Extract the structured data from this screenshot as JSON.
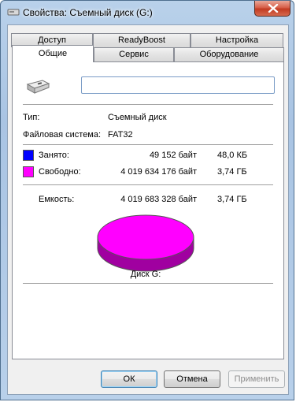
{
  "window": {
    "title": "Свойства: Съемный диск (G:)"
  },
  "tabs_row1": [
    "Доступ",
    "ReadyBoost",
    "Настройка"
  ],
  "tabs_row2": [
    "Общие",
    "Сервис",
    "Оборудование"
  ],
  "general": {
    "drive_name_value": "",
    "type_label": "Тип:",
    "type_value": "Съемный диск",
    "fs_label": "Файловая система:",
    "fs_value": "FAT32",
    "used_label": "Занято:",
    "used_bytes": "49 152 байт",
    "used_size": "48,0 КБ",
    "free_label": "Свободно:",
    "free_bytes": "4 019 634 176 байт",
    "free_size": "3,74 ГБ",
    "capacity_label": "Емкость:",
    "capacity_bytes": "4 019 683 328 байт",
    "capacity_size": "3,74 ГБ",
    "disk_label": "Диск G:"
  },
  "colors": {
    "used": "#0000ff",
    "free": "#ff00ff"
  },
  "buttons": {
    "ok": "ОК",
    "cancel": "Отмена",
    "apply": "Применить"
  }
}
